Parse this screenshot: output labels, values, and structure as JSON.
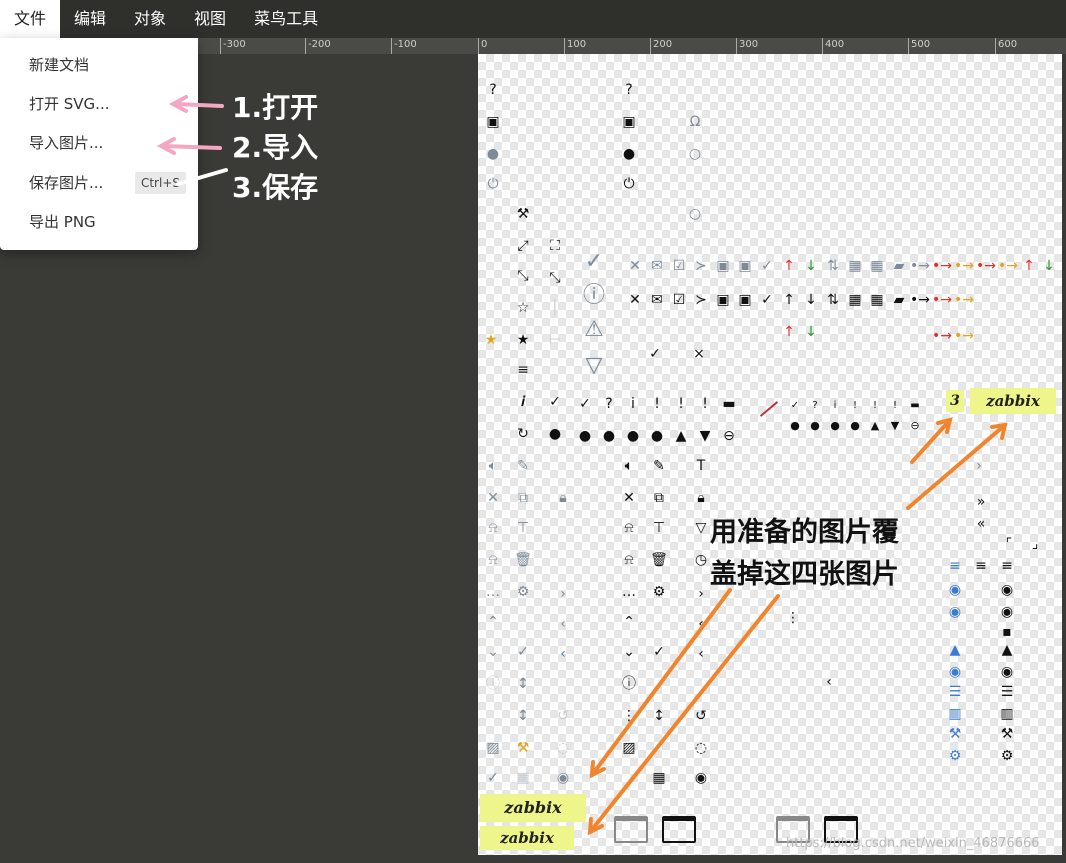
{
  "menubar": [
    "文件",
    "编辑",
    "对象",
    "视图",
    "菜鸟工具"
  ],
  "ruler": [
    "-300",
    "-200",
    "-100",
    "0",
    "100",
    "200",
    "300",
    "400",
    "500",
    "600"
  ],
  "dropdown": {
    "items": [
      {
        "label": "新建文档"
      },
      {
        "label": "打开 SVG..."
      },
      {
        "label": "导入图片..."
      },
      {
        "label": "保存图片...",
        "shortcut": "Ctrl+S"
      },
      {
        "label": "导出 PNG"
      }
    ]
  },
  "annotations": {
    "step1": "1.打开",
    "step2": "2.导入",
    "step3": "3.保存",
    "note_line1": "用准备的图片覆",
    "note_line2": "盖掉这四张图片"
  },
  "zabbix_logos": [
    "3",
    "zabbix",
    "zabbix",
    "zabbix"
  ],
  "watermark": "https://blog.csdn.net/weixin_46876666",
  "colors": {
    "annotation_arrow": "#f0852d",
    "menu_arrow": "#f5a6c2",
    "logo_bg": "#eef58a"
  }
}
